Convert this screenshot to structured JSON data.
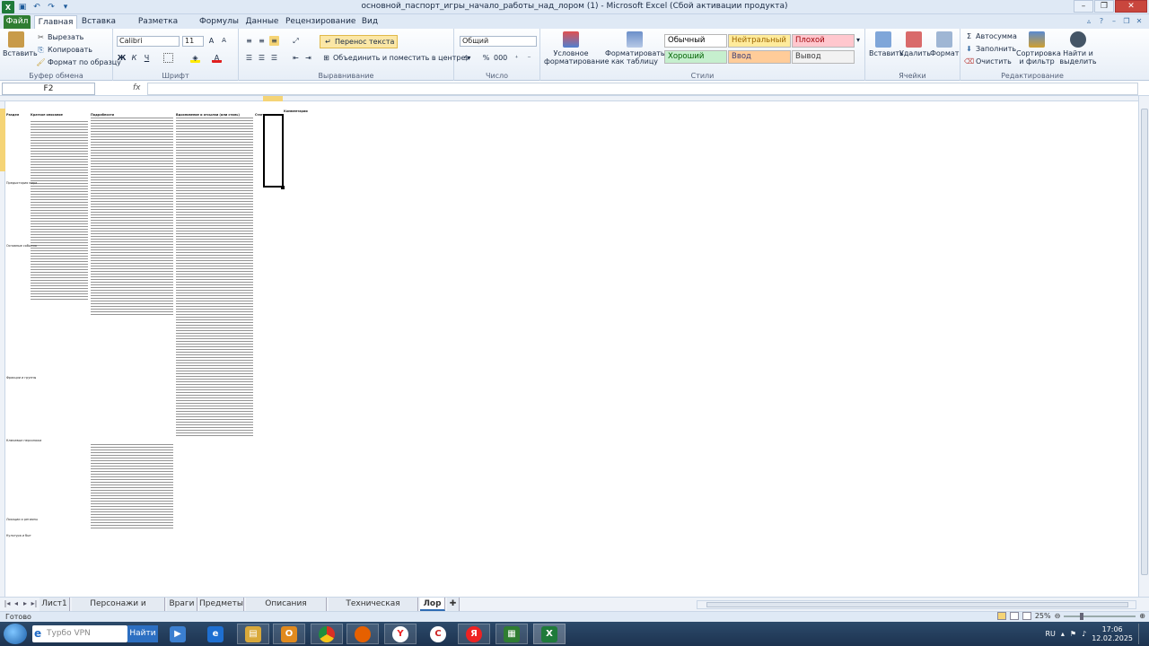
{
  "window": {
    "title": "основной_паспорт_игры_начало_работы_над_лором (1) - Microsoft Excel (Сбой активации продукта)"
  },
  "ribbon_tabs": [
    "Файл",
    "Главная",
    "Вставка",
    "Разметка страницы",
    "Формулы",
    "Данные",
    "Рецензирование",
    "Вид"
  ],
  "ribbon": {
    "clipboard": {
      "label": "Буфер обмена",
      "paste": "Вставить",
      "cut": "Вырезать",
      "copy": "Копировать",
      "format_painter": "Формат по образцу"
    },
    "font": {
      "label": "Шрифт",
      "font_name": "Calibri",
      "font_size": "11"
    },
    "alignment": {
      "label": "Выравнивание",
      "wrap": "Перенос текста",
      "merge": "Объединить и поместить в центре"
    },
    "number": {
      "label": "Число",
      "format": "Общий"
    },
    "styles": {
      "label": "Стили",
      "conditional": "Условное форматирование",
      "as_table": "Форматировать как таблицу",
      "cells": [
        {
          "name": "Обычный",
          "bg": "#ffffff",
          "fg": "#000000"
        },
        {
          "name": "Нейтральный",
          "bg": "#ffeb9c",
          "fg": "#9c6500"
        },
        {
          "name": "Плохой",
          "bg": "#ffc7ce",
          "fg": "#9c0006"
        },
        {
          "name": "Хороший",
          "bg": "#c6efce",
          "fg": "#006100"
        },
        {
          "name": "Ввод",
          "bg": "#ffcc99",
          "fg": "#3f3f76"
        },
        {
          "name": "Вывод",
          "bg": "#f2f2f2",
          "fg": "#3f3f3f"
        }
      ]
    },
    "cells": {
      "label": "Ячейки",
      "insert": "Вставить",
      "delete": "Удалить",
      "format": "Формат"
    },
    "editing": {
      "label": "Редактирование",
      "autosum": "Автосумма",
      "fill": "Заполнить",
      "clear": "Очистить",
      "sort": "Сортировка и фильтр",
      "find": "Найти и выделить"
    }
  },
  "formula_bar": {
    "name_box": "F2",
    "fx": "fx",
    "value": ""
  },
  "sheet_headers": [
    "Раздел",
    "Краткое описание",
    "Подробности",
    "Вдохновение и отсылки (или стиль)",
    "Статус",
    "Комментарии"
  ],
  "sheet_row_labels": [
    "Мир",
    "Предыстория мира",
    "Основные события",
    "Фракции и группы",
    "Ключевые персонажи",
    "Локации и регионы",
    "Культура и быт",
    "Магическая система"
  ],
  "sheet_tabs": [
    "Лист1",
    "Персонажи и существа",
    "Враги",
    "Предметы",
    "Описания локаций",
    "Техническая сторона",
    "Лор"
  ],
  "active_sheet": "Лор",
  "status": {
    "text": "Готово",
    "zoom": "25%"
  },
  "taskbar": {
    "search_placeholder": "Турбо VPN",
    "search_button": "Найти",
    "lang": "RU",
    "time": "17:06",
    "date": "12.02.2025"
  }
}
